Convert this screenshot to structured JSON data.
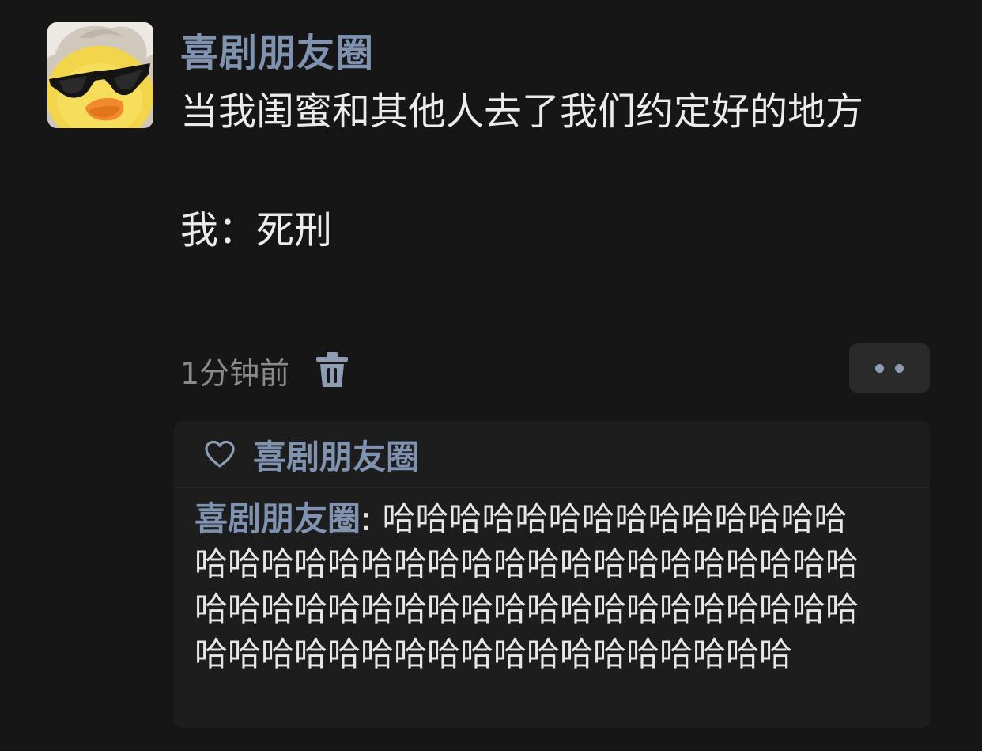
{
  "post": {
    "avatar_icon": "duck-with-sunglasses-avatar",
    "author": "喜剧朋友圈",
    "text": "当我闺蜜和其他人去了我们约定好的地方\n\n我：死刑",
    "timestamp": "1分钟前",
    "delete_icon": "trash-icon",
    "more_icon": "more-dots-icon"
  },
  "likes": {
    "icon": "heart-outline-icon",
    "names": "喜剧朋友圈"
  },
  "comments": [
    {
      "author": "喜剧朋友圈",
      "separator": ": ",
      "text": "哈哈哈哈哈哈哈哈哈哈哈哈哈哈哈哈哈哈哈哈哈哈哈哈哈哈哈哈哈哈哈哈哈哈哈哈哈哈哈哈哈哈哈哈哈哈哈哈哈哈哈哈哈哈哈哈哈哈哈哈哈哈哈哈哈哈哈哈哈哈哈哈"
    }
  ],
  "colors": {
    "background": "#161616",
    "name_blue": "#7f92b0",
    "text": "#ececec",
    "muted": "#8a8a8a",
    "panel": "#1d1d1d"
  }
}
